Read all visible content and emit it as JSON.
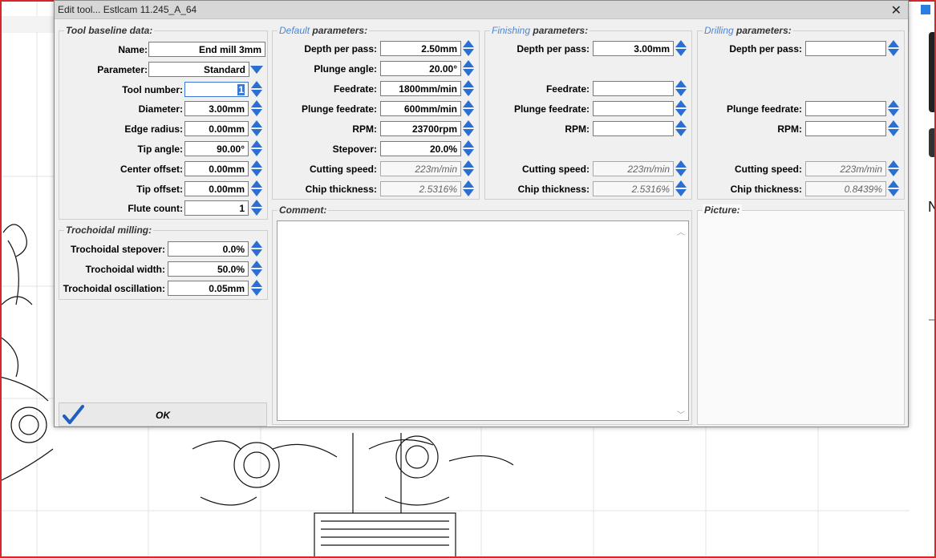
{
  "window": {
    "title": "Edit tool... Estlcam 11.245_A_64",
    "close_glyph": "✕"
  },
  "colors": {
    "accent_legend": "#4a86d4",
    "spin_blue": "#2a6fd1",
    "frame_red": "#d8262b"
  },
  "baseline": {
    "legend": "Tool baseline data:",
    "name_label": "Name:",
    "name_value": "End mill 3mm",
    "parameter_label": "Parameter:",
    "parameter_value": "Standard",
    "tool_number_label": "Tool number:",
    "tool_number_value": "1",
    "diameter_label": "Diameter:",
    "diameter_value": "3.00mm",
    "edge_radius_label": "Edge radius:",
    "edge_radius_value": "0.00mm",
    "tip_angle_label": "Tip angle:",
    "tip_angle_value": "90.00°",
    "center_offset_label": "Center offset:",
    "center_offset_value": "0.00mm",
    "tip_offset_label": "Tip offset:",
    "tip_offset_value": "0.00mm",
    "flute_count_label": "Flute count:",
    "flute_count_value": "1"
  },
  "trochoidal": {
    "legend": "Trochoidal milling:",
    "stepover_label": "Trochoidal stepover:",
    "stepover_value": "0.0%",
    "width_label": "Trochoidal width:",
    "width_value": "50.0%",
    "oscillation_label": "Trochoidal oscillation:",
    "oscillation_value": "0.05mm"
  },
  "default": {
    "legend_accent": "Default",
    "legend_rest": "parameters:",
    "depth_label": "Depth per pass:",
    "depth_value": "2.50mm",
    "plunge_angle_label": "Plunge angle:",
    "plunge_angle_value": "20.00°",
    "feedrate_label": "Feedrate:",
    "feedrate_value": "1800mm/min",
    "plunge_feed_label": "Plunge feedrate:",
    "plunge_feed_value": "600mm/min",
    "rpm_label": "RPM:",
    "rpm_value": "23700rpm",
    "stepover_label": "Stepover:",
    "stepover_value": "20.0%",
    "cutting_speed_label": "Cutting speed:",
    "cutting_speed_value": "223m/min",
    "chip_label": "Chip thickness:",
    "chip_value": "2.5316%"
  },
  "finishing": {
    "legend_accent": "Finishing",
    "legend_rest": "parameters:",
    "depth_label": "Depth per pass:",
    "depth_value": "3.00mm",
    "feedrate_label": "Feedrate:",
    "feedrate_value": "",
    "plunge_feed_label": "Plunge feedrate:",
    "plunge_feed_value": "",
    "rpm_label": "RPM:",
    "rpm_value": "",
    "cutting_speed_label": "Cutting speed:",
    "cutting_speed_value": "223m/min",
    "chip_label": "Chip thickness:",
    "chip_value": "2.5316%"
  },
  "drilling": {
    "legend_accent": "Drilling",
    "legend_rest": "parameters:",
    "depth_label": "Depth per pass:",
    "depth_value": "",
    "plunge_feed_label": "Plunge feedrate:",
    "plunge_feed_value": "",
    "rpm_label": "RPM:",
    "rpm_value": "",
    "cutting_speed_label": "Cutting speed:",
    "cutting_speed_value": "223m/min",
    "chip_label": "Chip thickness:",
    "chip_value": "0.8439%"
  },
  "comment": {
    "legend": "Comment:",
    "value": ""
  },
  "picture": {
    "legend": "Picture:"
  },
  "ok_button": {
    "label": "OK"
  },
  "right_strip": {
    "letter": "N"
  }
}
